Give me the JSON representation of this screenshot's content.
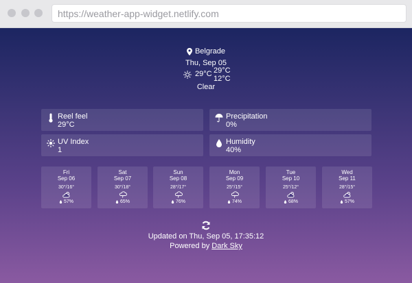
{
  "browser": {
    "url": "https://weather-app-widget.netlify.com"
  },
  "location": "Belgrade",
  "date": "Thu, Sep 05",
  "current": {
    "temp": "29°C",
    "high": "29°C",
    "low": "12°C",
    "condition": "Clear",
    "icon": "sun-icon"
  },
  "metrics": [
    {
      "label": "Reel feel",
      "value": "29°C",
      "icon": "thermometer-icon"
    },
    {
      "label": "Precipitation",
      "value": "0%",
      "icon": "umbrella-icon"
    },
    {
      "label": "UV Index",
      "value": "1",
      "icon": "uv-sun-icon"
    },
    {
      "label": "Humidity",
      "value": "40%",
      "icon": "droplet-icon"
    }
  ],
  "forecast": [
    {
      "day": "Fri",
      "date": "Sep 06",
      "temps": "30°/16°",
      "icon": "partly-cloudy-icon",
      "humidity": "57%"
    },
    {
      "day": "Sat",
      "date": "Sep 07",
      "temps": "30°/18°",
      "icon": "rain-icon",
      "humidity": "65%"
    },
    {
      "day": "Sun",
      "date": "Sep 08",
      "temps": "28°/17°",
      "icon": "rain-icon",
      "humidity": "76%"
    },
    {
      "day": "Mon",
      "date": "Sep 09",
      "temps": "25°/15°",
      "icon": "rain-icon",
      "humidity": "74%"
    },
    {
      "day": "Tue",
      "date": "Sep 10",
      "temps": "25°/12°",
      "icon": "partly-cloudy-icon",
      "humidity": "68%"
    },
    {
      "day": "Wed",
      "date": "Sep 11",
      "temps": "28°/15°",
      "icon": "partly-cloudy-icon",
      "humidity": "57%"
    }
  ],
  "footer": {
    "updated": "Updated on Thu, Sep 05, 17:35:12",
    "powered_prefix": "Powered by",
    "powered_link": "Dark Sky"
  }
}
